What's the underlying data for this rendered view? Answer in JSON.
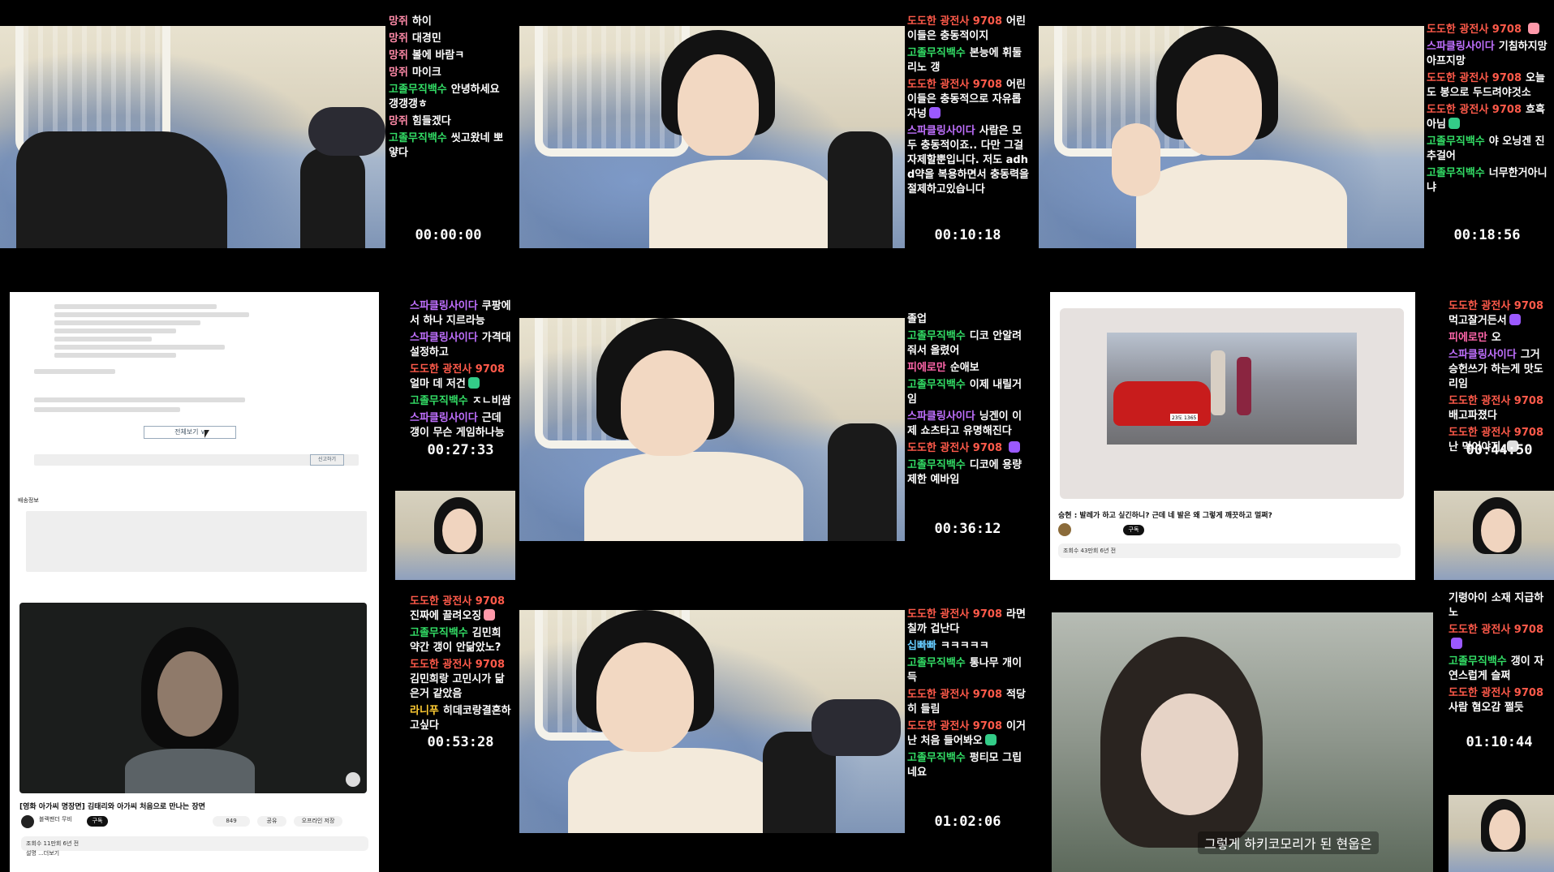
{
  "colors": {
    "background": "#000000",
    "username_colors": {
      "망쥐": "#ff8aa8",
      "고졸무직백수": "#33dd66",
      "도도한 광전사 9708": "#ff5a4a",
      "스파클링사이다": "#c070ff",
      "피에로만": "#ff66aa",
      "십빠빠": "#66ccff",
      "라니푸": "#ffcc33",
      "기령아이": "#ffffff"
    }
  },
  "tiles": [
    {
      "timestamp": "00:00:00",
      "chat": [
        {
          "user": "망쥐",
          "color": "#ff8aa8",
          "text": "하이"
        },
        {
          "user": "망쥐",
          "color": "#ff8aa8",
          "text": "대경민"
        },
        {
          "user": "망쥐",
          "color": "#ff8aa8",
          "text": "볼에 바람ㅋ"
        },
        {
          "user": "망쥐",
          "color": "#ff8aa8",
          "text": "마이크"
        },
        {
          "user": "고졸무직백수",
          "color": "#33dd66",
          "text": "안녕하세요 갱갱갱ㅎ"
        },
        {
          "user": "망쥐",
          "color": "#ff8aa8",
          "text": "힘들겠다"
        },
        {
          "user": "고졸무직백수",
          "color": "#33dd66",
          "text": "씻고왔네 뽀얗다"
        }
      ]
    },
    {
      "timestamp": "00:10:18",
      "chat": [
        {
          "user": "도도한 광전사 9708",
          "color": "#ff5a4a",
          "text": "어린이들은 충동적이지"
        },
        {
          "user": "고졸무직백수",
          "color": "#33dd66",
          "text": "본능에 휘둘리노 갱"
        },
        {
          "user": "도도한 광전사 9708",
          "color": "#ff5a4a",
          "text": "어린이들은 충동적으로 자유롭자넝",
          "emoji": "#9b59ff"
        },
        {
          "user": "스파클링사이다",
          "color": "#c070ff",
          "text": "사람은 모두 충동적이죠.. 다만 그걸 자제할뿐입니다. 저도 adhd약을 복용하면서 충동력을 절제하고있습니다"
        }
      ]
    },
    {
      "timestamp": "00:18:56",
      "chat": [
        {
          "user": "도도한 광전사 9708",
          "color": "#ff5a4a",
          "text": "",
          "emoji": "#ff99aa"
        },
        {
          "user": "스파클링사이다",
          "color": "#c070ff",
          "text": "기침하지망 아프지망"
        },
        {
          "user": "도도한 광전사 9708",
          "color": "#ff5a4a",
          "text": "오늘도 봉으로 두드려야것소"
        },
        {
          "user": "도도한 광전사 9708",
          "color": "#ff5a4a",
          "text": "흐흑 아님",
          "emoji": "#33cc88"
        },
        {
          "user": "고졸무직백수",
          "color": "#33dd66",
          "text": "야 오닝겐 진 추걸어"
        },
        {
          "user": "고졸무직백수",
          "color": "#33dd66",
          "text": "너무한거아니냐"
        }
      ]
    },
    {
      "timestamp": "00:27:33",
      "chat": [
        {
          "user": "스파클링사이다",
          "color": "#c070ff",
          "text": "쿠팡에서 하나 지르라능"
        },
        {
          "user": "스파클링사이다",
          "color": "#c070ff",
          "text": "가격대 설정하고"
        },
        {
          "user": "도도한 광전사 9708",
          "color": "#ff5a4a",
          "text": "얼마 데 저건",
          "emoji": "#33cc88"
        },
        {
          "user": "고졸무직백수",
          "color": "#33dd66",
          "text": "ㅈㄴ비쌈"
        },
        {
          "user": "스파클링사이다",
          "color": "#c070ff",
          "text": "근데 갱이 무슨 게임하나능"
        }
      ],
      "doc": {
        "more_button": "전체보기 ∨",
        "section_title": "배송정보",
        "report_button": "신고하기"
      }
    },
    {
      "timestamp": "00:36:12",
      "chat": [
        {
          "user": "",
          "color": "#ffffff",
          "text": "졸업"
        },
        {
          "user": "고졸무직백수",
          "color": "#33dd66",
          "text": "디코 안알려줘서 올렸어"
        },
        {
          "user": "피에로만",
          "color": "#ff66aa",
          "text": "순애보"
        },
        {
          "user": "고졸무직백수",
          "color": "#33dd66",
          "text": "이제 내릴거임"
        },
        {
          "user": "스파클링사이다",
          "color": "#c070ff",
          "text": "닝겐이 이제 쇼츠타고 유명해진다"
        },
        {
          "user": "도도한 광전사 9708",
          "color": "#ff5a4a",
          "text": "",
          "emoji": "#9b59ff"
        },
        {
          "user": "고졸무직백수",
          "color": "#33dd66",
          "text": "디코에 용량 제한 예바임"
        }
      ]
    },
    {
      "timestamp": "00:44:50",
      "chat": [
        {
          "user": "도도한 광전사 9708",
          "color": "#ff5a4a",
          "text": "먹고잘거든서",
          "emoji": "#9b59ff"
        },
        {
          "user": "피에로만",
          "color": "#ff66aa",
          "text": "오"
        },
        {
          "user": "스파클링사이다",
          "color": "#c070ff",
          "text": "그거 승헌쓰가 하는게 맛도리임"
        },
        {
          "user": "도도한 광전사 9708",
          "color": "#ff5a4a",
          "text": "배고파졌다"
        },
        {
          "user": "도도한 광전사 9708",
          "color": "#ff5a4a",
          "text": "난 먹어야지.",
          "emoji": "#dddddd"
        }
      ],
      "video": {
        "title": "승현 : 발레가 하고 싶긴하니? 근데 네 발은 왜 그렇게 깨끗하고 멀쩌?",
        "subscribe": "구독",
        "views": "조회수 43만회 6년 전",
        "plate": "23도 1365"
      }
    },
    {
      "timestamp": "00:53:28",
      "chat": [
        {
          "user": "도도한 광전사 9708",
          "color": "#ff5a4a",
          "text": "진짜에 끌려오징",
          "emoji": "#ff99aa"
        },
        {
          "user": "고졸무직백수",
          "color": "#33dd66",
          "text": "김민희 약간 갱이 안닮았노?"
        },
        {
          "user": "도도한 광전사 9708",
          "color": "#ff5a4a",
          "text": "김민희랑 고민시가 닮은거 같았음"
        },
        {
          "user": "라니푸",
          "color": "#ffcc33",
          "text": "히데코랑결혼하고싶다"
        }
      ],
      "video": {
        "title": "[영화 아가씨 명장면] 김태리와 아가씨 처음으로 만나는 장면",
        "channel": "블랙팬더 무비",
        "subscribe": "구독",
        "likes": "849",
        "share": "공유",
        "save": "오프라인 저장",
        "views": "조회수 11만회 6년 전",
        "desc": "설명 ...더보기"
      }
    },
    {
      "timestamp": "01:02:06",
      "chat": [
        {
          "user": "도도한 광전사 9708",
          "color": "#ff5a4a",
          "text": "라면 칠까 겁난다"
        },
        {
          "user": "십빠빠",
          "color": "#66ccff",
          "text": "ㅋㅋㅋㅋㅋ"
        },
        {
          "user": "고졸무직백수",
          "color": "#33dd66",
          "text": "통나무 개이득"
        },
        {
          "user": "도도한 광전사 9708",
          "color": "#ff5a4a",
          "text": "적당히 들림"
        },
        {
          "user": "도도한 광전사 9708",
          "color": "#ff5a4a",
          "text": "이거 난 처음 들어봐오",
          "emoji": "#33cc88"
        },
        {
          "user": "고졸무직백수",
          "color": "#33dd66",
          "text": "펑티모 그립네요"
        }
      ]
    },
    {
      "timestamp": "01:10:44",
      "chat": [
        {
          "user": "기령아이",
          "color": "#ffffff",
          "text": "소재 지급하노"
        },
        {
          "user": "도도한 광전사 9708",
          "color": "#ff5a4a",
          "text": "",
          "emoji": "#9b59ff"
        },
        {
          "user": "고졸무직백수",
          "color": "#33dd66",
          "text": "갱이 자연스럽게 슬쩌"
        },
        {
          "user": "도도한 광전사 9708",
          "color": "#ff5a4a",
          "text": "사람 혐오감 쩔듯"
        }
      ],
      "subtitle": "그렇게 하키코모리가 된 현웁은"
    }
  ]
}
